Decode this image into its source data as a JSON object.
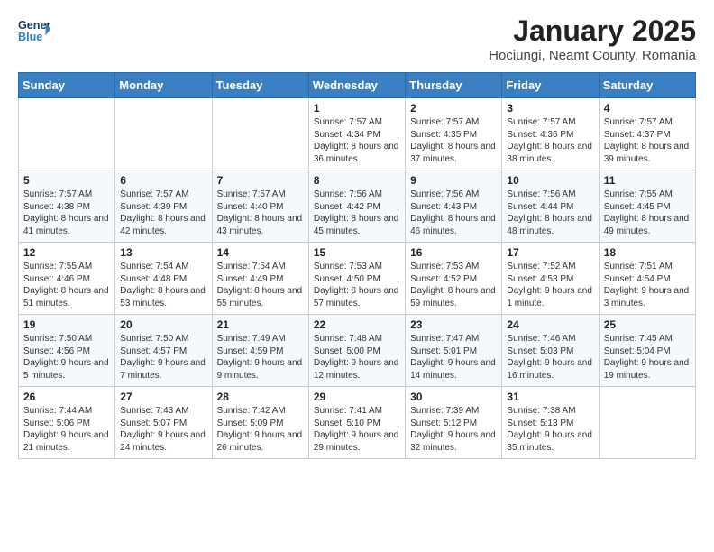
{
  "header": {
    "logo_line1": "General",
    "logo_line2": "Blue",
    "month": "January 2025",
    "location": "Hociungi, Neamt County, Romania"
  },
  "weekdays": [
    "Sunday",
    "Monday",
    "Tuesday",
    "Wednesday",
    "Thursday",
    "Friday",
    "Saturday"
  ],
  "weeks": [
    [
      {
        "day": "",
        "content": ""
      },
      {
        "day": "",
        "content": ""
      },
      {
        "day": "",
        "content": ""
      },
      {
        "day": "1",
        "content": "Sunrise: 7:57 AM\nSunset: 4:34 PM\nDaylight: 8 hours and 36 minutes."
      },
      {
        "day": "2",
        "content": "Sunrise: 7:57 AM\nSunset: 4:35 PM\nDaylight: 8 hours and 37 minutes."
      },
      {
        "day": "3",
        "content": "Sunrise: 7:57 AM\nSunset: 4:36 PM\nDaylight: 8 hours and 38 minutes."
      },
      {
        "day": "4",
        "content": "Sunrise: 7:57 AM\nSunset: 4:37 PM\nDaylight: 8 hours and 39 minutes."
      }
    ],
    [
      {
        "day": "5",
        "content": "Sunrise: 7:57 AM\nSunset: 4:38 PM\nDaylight: 8 hours and 41 minutes."
      },
      {
        "day": "6",
        "content": "Sunrise: 7:57 AM\nSunset: 4:39 PM\nDaylight: 8 hours and 42 minutes."
      },
      {
        "day": "7",
        "content": "Sunrise: 7:57 AM\nSunset: 4:40 PM\nDaylight: 8 hours and 43 minutes."
      },
      {
        "day": "8",
        "content": "Sunrise: 7:56 AM\nSunset: 4:42 PM\nDaylight: 8 hours and 45 minutes."
      },
      {
        "day": "9",
        "content": "Sunrise: 7:56 AM\nSunset: 4:43 PM\nDaylight: 8 hours and 46 minutes."
      },
      {
        "day": "10",
        "content": "Sunrise: 7:56 AM\nSunset: 4:44 PM\nDaylight: 8 hours and 48 minutes."
      },
      {
        "day": "11",
        "content": "Sunrise: 7:55 AM\nSunset: 4:45 PM\nDaylight: 8 hours and 49 minutes."
      }
    ],
    [
      {
        "day": "12",
        "content": "Sunrise: 7:55 AM\nSunset: 4:46 PM\nDaylight: 8 hours and 51 minutes."
      },
      {
        "day": "13",
        "content": "Sunrise: 7:54 AM\nSunset: 4:48 PM\nDaylight: 8 hours and 53 minutes."
      },
      {
        "day": "14",
        "content": "Sunrise: 7:54 AM\nSunset: 4:49 PM\nDaylight: 8 hours and 55 minutes."
      },
      {
        "day": "15",
        "content": "Sunrise: 7:53 AM\nSunset: 4:50 PM\nDaylight: 8 hours and 57 minutes."
      },
      {
        "day": "16",
        "content": "Sunrise: 7:53 AM\nSunset: 4:52 PM\nDaylight: 8 hours and 59 minutes."
      },
      {
        "day": "17",
        "content": "Sunrise: 7:52 AM\nSunset: 4:53 PM\nDaylight: 9 hours and 1 minute."
      },
      {
        "day": "18",
        "content": "Sunrise: 7:51 AM\nSunset: 4:54 PM\nDaylight: 9 hours and 3 minutes."
      }
    ],
    [
      {
        "day": "19",
        "content": "Sunrise: 7:50 AM\nSunset: 4:56 PM\nDaylight: 9 hours and 5 minutes."
      },
      {
        "day": "20",
        "content": "Sunrise: 7:50 AM\nSunset: 4:57 PM\nDaylight: 9 hours and 7 minutes."
      },
      {
        "day": "21",
        "content": "Sunrise: 7:49 AM\nSunset: 4:59 PM\nDaylight: 9 hours and 9 minutes."
      },
      {
        "day": "22",
        "content": "Sunrise: 7:48 AM\nSunset: 5:00 PM\nDaylight: 9 hours and 12 minutes."
      },
      {
        "day": "23",
        "content": "Sunrise: 7:47 AM\nSunset: 5:01 PM\nDaylight: 9 hours and 14 minutes."
      },
      {
        "day": "24",
        "content": "Sunrise: 7:46 AM\nSunset: 5:03 PM\nDaylight: 9 hours and 16 minutes."
      },
      {
        "day": "25",
        "content": "Sunrise: 7:45 AM\nSunset: 5:04 PM\nDaylight: 9 hours and 19 minutes."
      }
    ],
    [
      {
        "day": "26",
        "content": "Sunrise: 7:44 AM\nSunset: 5:06 PM\nDaylight: 9 hours and 21 minutes."
      },
      {
        "day": "27",
        "content": "Sunrise: 7:43 AM\nSunset: 5:07 PM\nDaylight: 9 hours and 24 minutes."
      },
      {
        "day": "28",
        "content": "Sunrise: 7:42 AM\nSunset: 5:09 PM\nDaylight: 9 hours and 26 minutes."
      },
      {
        "day": "29",
        "content": "Sunrise: 7:41 AM\nSunset: 5:10 PM\nDaylight: 9 hours and 29 minutes."
      },
      {
        "day": "30",
        "content": "Sunrise: 7:39 AM\nSunset: 5:12 PM\nDaylight: 9 hours and 32 minutes."
      },
      {
        "day": "31",
        "content": "Sunrise: 7:38 AM\nSunset: 5:13 PM\nDaylight: 9 hours and 35 minutes."
      },
      {
        "day": "",
        "content": ""
      }
    ]
  ]
}
